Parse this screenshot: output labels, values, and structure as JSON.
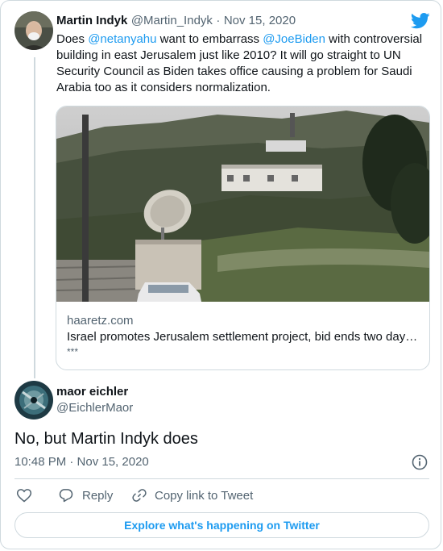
{
  "original_tweet": {
    "author_name": "Martin Indyk",
    "author_handle": "@Martin_Indyk",
    "separator": "·",
    "date": "Nov 15, 2020",
    "text_before_mention_1": "Does ",
    "mention_1": "@netanyahu",
    "text_between_mentions": " want to embarrass ",
    "mention_2": "@JoeBiden",
    "text_after_mentions": " with controversial building in east Jerusalem just like 2010? It will go straight to UN Security Council as Biden takes office causing a problem for Saudi Arabia too as it considers normalization.",
    "link_card": {
      "domain": "haaretz.com",
      "title": "Israel promotes Jerusalem settlement project, bid ends two day…",
      "subtitle": "***"
    }
  },
  "reply_tweet": {
    "author_name": "maor eichler",
    "author_handle": "@EichlerMaor",
    "text": "No, but Martin Indyk does",
    "timestamp": "10:48 PM · Nov 15, 2020"
  },
  "actions": {
    "reply_label": "Reply",
    "copy_link_label": "Copy link to Tweet"
  },
  "footer": {
    "explore_label": "Explore what's happening on Twitter"
  },
  "colors": {
    "twitter_blue": "#1d9bf0",
    "text_primary": "#0f1419",
    "text_secondary": "#536471",
    "border": "#cfd9de"
  },
  "icons": [
    "twitter-bird-icon",
    "heart-icon",
    "reply-icon",
    "link-icon",
    "info-icon"
  ]
}
